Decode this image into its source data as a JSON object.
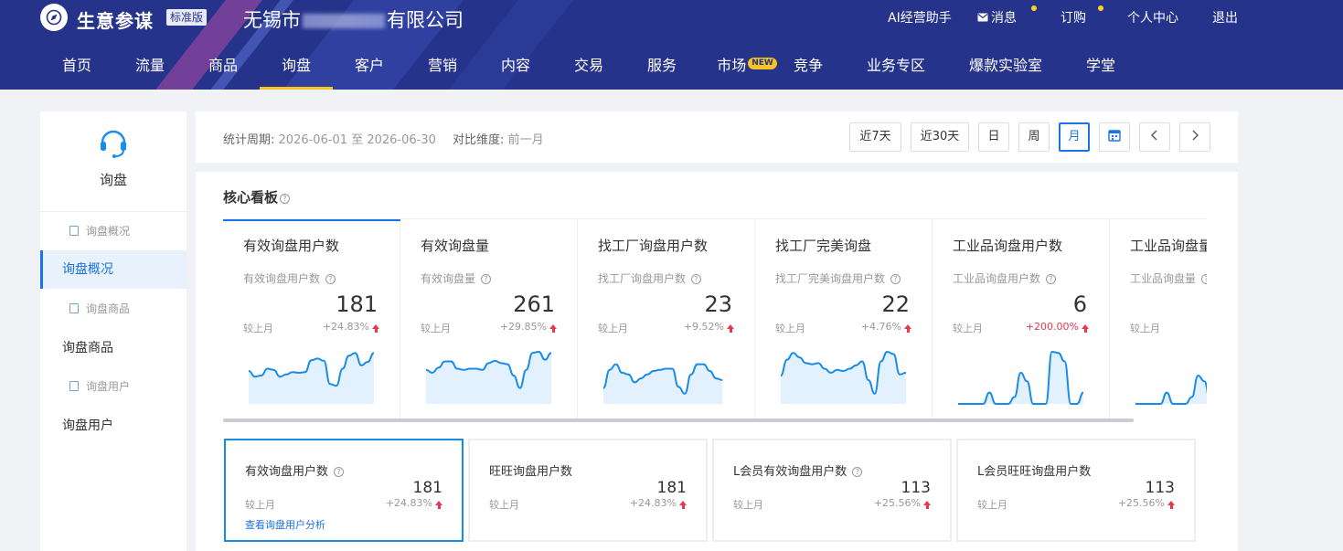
{
  "brand": {
    "name": "生意参谋",
    "edition": "标准版",
    "company_prefix": "无锡市",
    "company_suffix": "有限公司"
  },
  "topnav": {
    "ai": "AI经营助手",
    "message": "消息",
    "order": "订购",
    "profile": "个人中心",
    "logout": "退出"
  },
  "mainnav": [
    "首页",
    "流量",
    "商品",
    "询盘",
    "客户",
    "营销",
    "内容",
    "交易",
    "服务",
    "市场",
    "竞争",
    "业务专区",
    "爆款实验室",
    "学堂"
  ],
  "mainnav_new_badge": "NEW",
  "sidebar": {
    "title": "询盘",
    "items": [
      {
        "label": "询盘概况",
        "type": "sub"
      },
      {
        "label": "询盘概况",
        "type": "main"
      },
      {
        "label": "询盘商品",
        "type": "sub"
      },
      {
        "label": "询盘商品",
        "type": "main"
      },
      {
        "label": "询盘用户",
        "type": "sub"
      },
      {
        "label": "询盘用户",
        "type": "main"
      }
    ]
  },
  "period": {
    "label": "统计周期:",
    "range": "2026-06-01 至 2026-06-30",
    "compare_label": "对比维度:",
    "compare_value": "前一月",
    "buttons": [
      "近7天",
      "近30天",
      "日",
      "周",
      "月"
    ]
  },
  "panel": {
    "title": "核心看板"
  },
  "metric_cards": [
    {
      "title": "有效询盘用户数",
      "sub": "有效询盘用户数",
      "value": "181",
      "cmp": "较上月",
      "pct": "+24.83%",
      "spark": [
        0.42,
        0.52,
        0.5,
        0.38,
        0.4,
        0.52,
        0.48,
        0.44,
        0.45,
        0.44,
        0.23,
        0.2,
        0.24,
        0.65,
        0.68,
        0.38,
        0.15,
        0.1,
        0.32,
        0.26,
        0.1
      ]
    },
    {
      "title": "有效询盘量",
      "sub": "有效询盘量",
      "value": "261",
      "cmp": "较上月",
      "pct": "+29.85%",
      "spark": [
        0.4,
        0.45,
        0.36,
        0.25,
        0.25,
        0.38,
        0.4,
        0.38,
        0.38,
        0.4,
        0.28,
        0.24,
        0.28,
        0.3,
        0.5,
        0.72,
        0.4,
        0.1,
        0.08,
        0.22,
        0.1
      ]
    },
    {
      "title": "找工厂询盘用户数",
      "sub": "找工厂询盘用户数",
      "value": "23",
      "cmp": "较上月",
      "pct": "+9.52%",
      "spark": [
        0.72,
        0.4,
        0.3,
        0.45,
        0.48,
        0.62,
        0.55,
        0.48,
        0.42,
        0.4,
        0.38,
        0.38,
        0.7,
        0.82,
        0.48,
        0.3,
        0.3,
        0.42,
        0.55,
        0.58
      ]
    },
    {
      "title": "找工厂完美询盘",
      "sub": "找工厂完美询盘用户数",
      "value": "22",
      "cmp": "较上月",
      "pct": "+4.76%",
      "spark": [
        0.5,
        0.22,
        0.1,
        0.18,
        0.28,
        0.3,
        0.28,
        0.38,
        0.45,
        0.4,
        0.42,
        0.38,
        0.32,
        0.25,
        0.58,
        0.82,
        0.25,
        0.08,
        0.12,
        0.48,
        0.45
      ]
    },
    {
      "title": "工业品询盘用户数",
      "sub": "工业品询盘用户数",
      "value": "6",
      "cmp": "较上月",
      "pct": "+200.00%",
      "pct_red": true,
      "spark": [
        1,
        1,
        1,
        1,
        1,
        0.8,
        1,
        1,
        1,
        0.88,
        0.45,
        0.6,
        1,
        1,
        1,
        0.08,
        0.1,
        0.25,
        1,
        1,
        0.8
      ]
    },
    {
      "title": "工业品询盘量",
      "sub": "工业品询盘量",
      "value": "",
      "cmp": "较上月",
      "pct": "+",
      "pct_red": true,
      "spark": [
        1,
        1,
        1,
        1,
        1,
        0.8,
        1,
        1,
        1,
        0.88,
        0.5,
        0.6,
        1,
        0.3,
        0.12,
        0.5,
        0.8,
        0.9
      ]
    }
  ],
  "mini_cards": [
    {
      "title": "有效询盘用户数",
      "has_q": true,
      "value": "181",
      "cmp": "较上月",
      "pct": "+24.83%",
      "link": "查看询盘用户分析"
    },
    {
      "title": "旺旺询盘用户数",
      "has_q": false,
      "value": "181",
      "cmp": "较上月",
      "pct": "+24.83%"
    },
    {
      "title": "L会员有效询盘用户数",
      "has_q": true,
      "value": "113",
      "cmp": "较上月",
      "pct": "+25.56%"
    },
    {
      "title": "L会员旺旺询盘用户数",
      "has_q": false,
      "value": "113",
      "cmp": "较上月",
      "pct": "+25.56%"
    }
  ],
  "colors": {
    "header_bg": "#26338a",
    "accent": "#1a73e8",
    "nav_active": "#f5c322",
    "up_red": "#e8384f",
    "spark_line": "#1a8ce8",
    "spark_fill": "#e3f0fd"
  }
}
